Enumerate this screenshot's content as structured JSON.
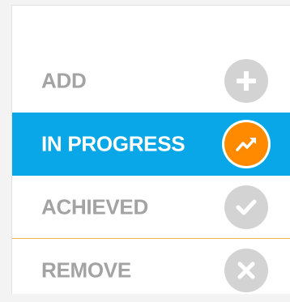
{
  "menu": {
    "items": [
      {
        "label": "ADD",
        "icon": "plus-icon",
        "active": false
      },
      {
        "label": "IN PROGRESS",
        "icon": "trending-up-icon",
        "active": true
      },
      {
        "label": "ACHIEVED",
        "icon": "checkmark-icon",
        "active": false
      },
      {
        "label": "REMOVE",
        "icon": "x-icon",
        "active": false
      }
    ]
  },
  "colors": {
    "active_background": "#0aa7e8",
    "active_icon": "#ff8a00",
    "inactive_text": "#a3a3a3",
    "inactive_icon": "#d3d3d3",
    "divider": "#f5b347"
  }
}
